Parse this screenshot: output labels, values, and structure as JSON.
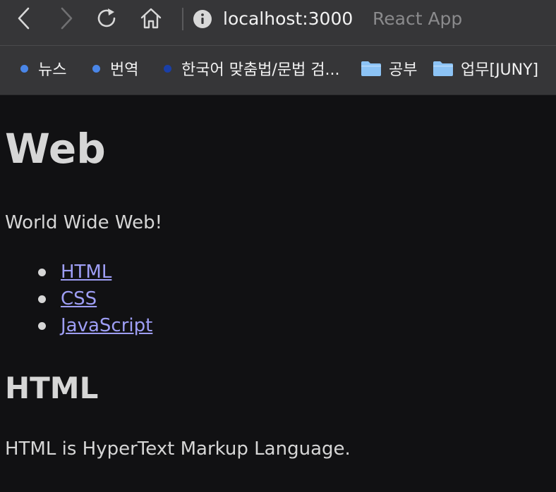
{
  "browser": {
    "url_host": "localhost:3000",
    "tab_title": "React App",
    "bookmarks": [
      {
        "label": "뉴스",
        "icon": "dot",
        "color": "#4a86e8"
      },
      {
        "label": "번역",
        "icon": "dot",
        "color": "#4a86e8"
      },
      {
        "label": "한국어 맞춤법/문법 검...",
        "icon": "dot",
        "color": "#1a3fa8"
      },
      {
        "label": "공부",
        "icon": "folder-icon",
        "color": "#8cc3f5"
      },
      {
        "label": "업무[JUNY]",
        "icon": "folder-icon",
        "color": "#8cc3f5"
      }
    ]
  },
  "page": {
    "title": "Web",
    "intro": "World Wide Web!",
    "topics": [
      {
        "label": "HTML"
      },
      {
        "label": "CSS"
      },
      {
        "label": "JavaScript"
      }
    ],
    "article_title": "HTML",
    "article_body": "HTML is HyperText Markup Language."
  },
  "colors": {
    "background": "#111113",
    "chrome": "#363638",
    "text": "#d6d6d6",
    "link": "#9e9ef5"
  }
}
